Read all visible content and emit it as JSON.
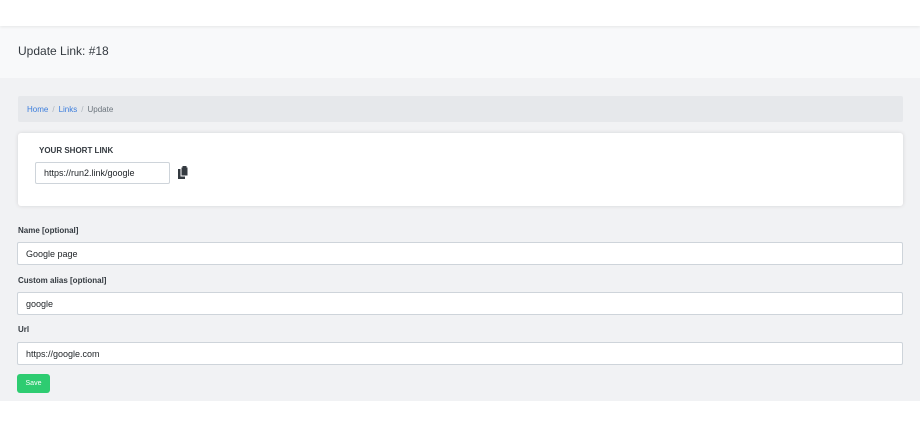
{
  "header": {
    "title": "Update Link: #18"
  },
  "breadcrumb": {
    "home": "Home",
    "links": "Links",
    "current": "Update",
    "separator": "/"
  },
  "short_link": {
    "title": "YOUR SHORT LINK",
    "value": "https://run2.link/google",
    "copy_icon": "copy-icon"
  },
  "form": {
    "name_label": "Name [optional]",
    "name_value": "Google page",
    "alias_label": "Custom alias [optional]",
    "alias_value": "google",
    "url_label": "Url",
    "url_value": "https://google.com",
    "save_label": "Save"
  },
  "colors": {
    "primary_link": "#3b7ddd",
    "save_button": "#2ecc71",
    "background": "#f1f2f4"
  }
}
